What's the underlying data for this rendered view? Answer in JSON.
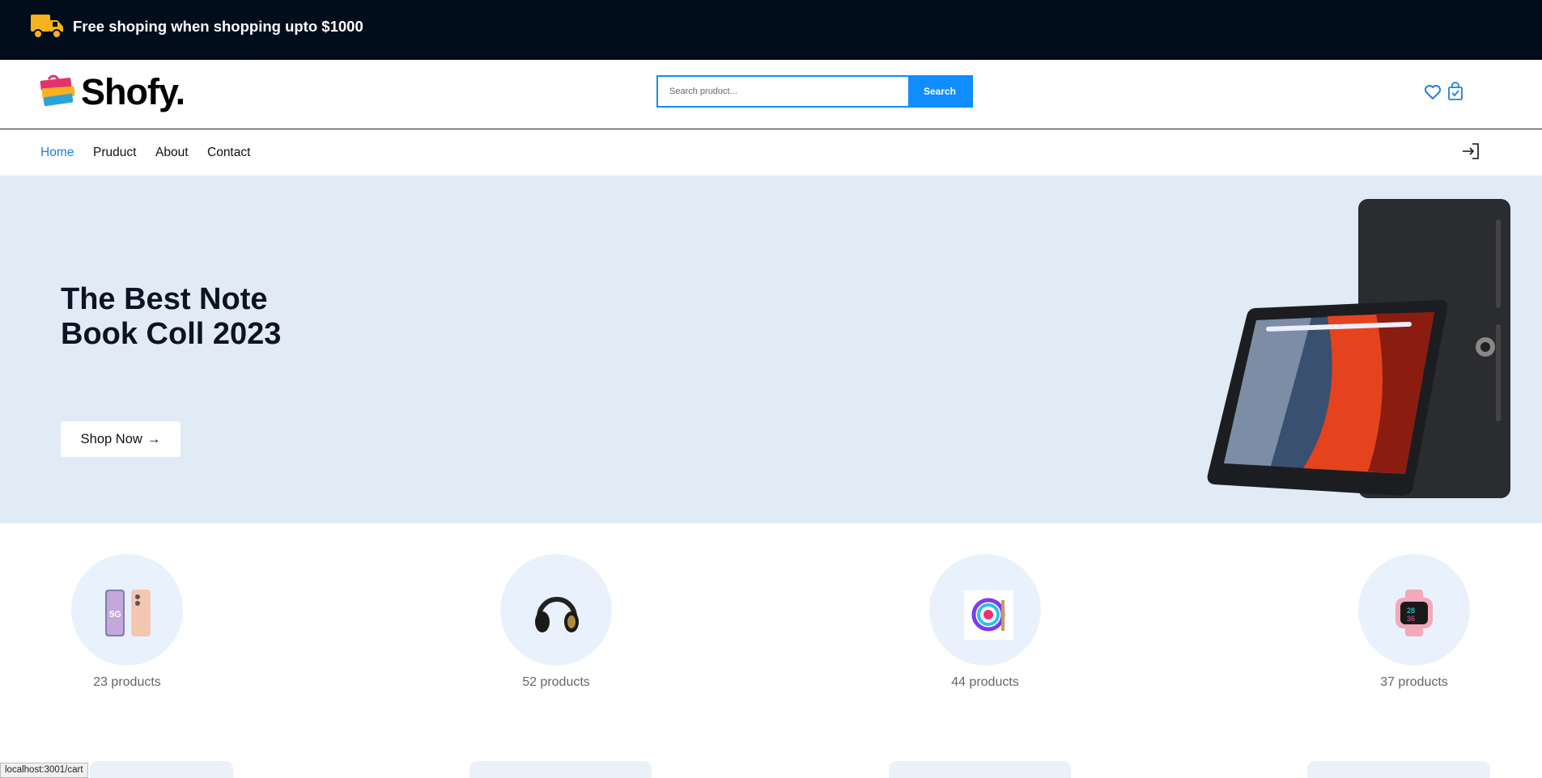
{
  "topbar": {
    "promo": "Free shoping when shopping upto $1000",
    "truck_icon": "truck-icon"
  },
  "header": {
    "brand": "Shofy.",
    "search": {
      "placeholder": "Search pruduct...",
      "button": "Search"
    },
    "icons": [
      "heart-icon",
      "shopping-bag-icon"
    ]
  },
  "nav": {
    "items": [
      {
        "label": "Home",
        "active": true
      },
      {
        "label": "Pruduct",
        "active": false
      },
      {
        "label": "About",
        "active": false
      },
      {
        "label": "Contact",
        "active": false
      }
    ],
    "login_icon": "sign-in-icon"
  },
  "hero": {
    "title": "The Best Note Book Coll 2023",
    "button": "Shop Now",
    "arrow": "→"
  },
  "categories": [
    {
      "image": "phone",
      "count": "23 products"
    },
    {
      "image": "headphones",
      "count": "52 products"
    },
    {
      "image": "cpu-cooler",
      "count": "44 products"
    },
    {
      "image": "smartwatch",
      "count": "37 products"
    }
  ],
  "status_bar": "localhost:3001/cart",
  "colors": {
    "topbar": "#020d1c",
    "accent": "#0f8dff",
    "hero_bg": "#e1ebf5",
    "truck": "#f7b21c"
  }
}
